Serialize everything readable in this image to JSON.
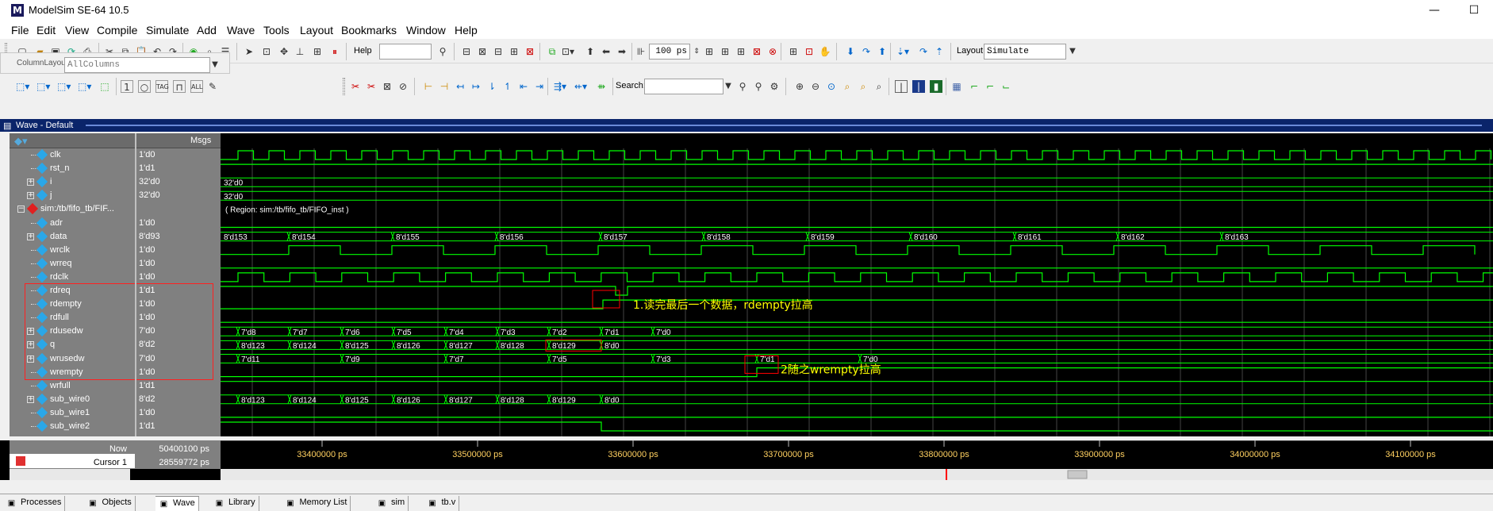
{
  "window": {
    "title": "ModelSim SE-64 10.5",
    "logo": "M"
  },
  "menu": [
    "File",
    "Edit",
    "View",
    "Compile",
    "Simulate",
    "Add",
    "Wave",
    "Tools",
    "Layout",
    "Bookmarks",
    "Window",
    "Help"
  ],
  "toolbar": {
    "help_label": "Help",
    "help_value": "",
    "run_length": "100 ps",
    "layout_label": "Layout",
    "layout_value": "Simulate",
    "column_layout_label": "ColumnLayout",
    "column_layout_value": "AllColumns",
    "search_label": "Search:",
    "search_value": ""
  },
  "wave": {
    "header_title": "Wave - Default",
    "msgs_label": "Msgs",
    "signals": [
      {
        "name": "clk",
        "value": "1'd0",
        "indent": 2,
        "expand": false
      },
      {
        "name": "rst_n",
        "value": "1'd1",
        "indent": 2,
        "expand": false
      },
      {
        "name": "i",
        "value": "32'd0",
        "indent": 2,
        "expand": true
      },
      {
        "name": "j",
        "value": "32'd0",
        "indent": 2,
        "expand": true
      },
      {
        "name": "sim:/tb/fifo_tb/FIF...",
        "value": "",
        "indent": 1,
        "expand": true,
        "instance": true
      },
      {
        "name": "adr",
        "value": "1'd0",
        "indent": 2,
        "expand": false
      },
      {
        "name": "data",
        "value": "8'd93",
        "indent": 2,
        "expand": true
      },
      {
        "name": "wrclk",
        "value": "1'd0",
        "indent": 2,
        "expand": false
      },
      {
        "name": "wrreq",
        "value": "1'd0",
        "indent": 2,
        "expand": false
      },
      {
        "name": "rdclk",
        "value": "1'd0",
        "indent": 2,
        "expand": false
      },
      {
        "name": "rdreq",
        "value": "1'd1",
        "indent": 2,
        "expand": false
      },
      {
        "name": "rdempty",
        "value": "1'd0",
        "indent": 2,
        "expand": false
      },
      {
        "name": "rdfull",
        "value": "1'd0",
        "indent": 2,
        "expand": false
      },
      {
        "name": "rdusedw",
        "value": "7'd0",
        "indent": 2,
        "expand": true
      },
      {
        "name": "q",
        "value": "8'd2",
        "indent": 2,
        "expand": true
      },
      {
        "name": "wrusedw",
        "value": "7'd0",
        "indent": 2,
        "expand": true
      },
      {
        "name": "wrempty",
        "value": "1'd0",
        "indent": 2,
        "expand": false
      },
      {
        "name": "wrfull",
        "value": "1'd1",
        "indent": 2,
        "expand": false
      },
      {
        "name": "sub_wire0",
        "value": "8'd2",
        "indent": 2,
        "expand": true
      },
      {
        "name": "sub_wire1",
        "value": "1'd0",
        "indent": 2,
        "expand": false
      },
      {
        "name": "sub_wire2",
        "value": "1'd1",
        "indent": 2,
        "expand": false
      }
    ],
    "bus_labels": {
      "i": [
        "32'd0"
      ],
      "j": [
        "32'd0"
      ],
      "region": "( Region: sim:/tb/fifo_tb/FIFO_inst )",
      "data": [
        "8'd153",
        "8'd154",
        "8'd155",
        "8'd156",
        "8'd157",
        "8'd158",
        "8'd159",
        "8'd160",
        "8'd161",
        "8'd162",
        "8'd163"
      ],
      "rdusedw": [
        "7'd8",
        "7'd7",
        "7'd6",
        "7'd5",
        "7'd4",
        "7'd3",
        "7'd2",
        "7'd1",
        "7'd0"
      ],
      "q": [
        "8'd123",
        "8'd124",
        "8'd125",
        "8'd126",
        "8'd127",
        "8'd128",
        "8'd129",
        "8'd0"
      ],
      "wrusedw": [
        "7'd11",
        "7'd9",
        "7'd7",
        "7'd5",
        "7'd3",
        "7'd1",
        "7'd0"
      ],
      "sub_wire0": [
        "8'd123",
        "8'd124",
        "8'd125",
        "8'd126",
        "8'd127",
        "8'd128",
        "8'd129",
        "8'd0"
      ]
    },
    "annotation1": "1.读完最后一个数据，rdempty拉高",
    "annotation2": "2随之wrempty拉高",
    "now_label": "Now",
    "now_value": "50400100 ps",
    "cursor_label": "Cursor 1",
    "cursor_value": "28559772 ps",
    "time_ticks": [
      "33400000 ps",
      "33500000 ps",
      "33600000 ps",
      "33700000 ps",
      "33800000 ps",
      "33900000 ps",
      "34000000 ps",
      "34100000 ps"
    ],
    "colors": {
      "trace": "#00ff00",
      "annotation": "#ffff00",
      "highlight": "#ff0000",
      "cursor": "#ff0000"
    }
  },
  "tabs": [
    {
      "label": "Processes",
      "icon": "gear-icon"
    },
    {
      "label": "Objects",
      "icon": "objects-icon"
    },
    {
      "label": "Wave",
      "icon": "wave-icon",
      "active": true
    },
    {
      "label": "Library",
      "icon": "library-icon"
    },
    {
      "label": "Memory List",
      "icon": "memory-icon"
    },
    {
      "label": "sim",
      "icon": "sim-icon"
    },
    {
      "label": "tb.v",
      "icon": "file-icon"
    }
  ]
}
